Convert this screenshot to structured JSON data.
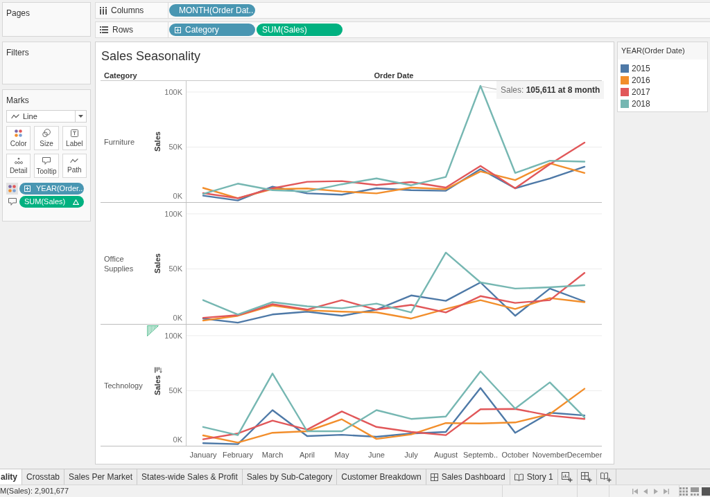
{
  "shelves": {
    "columns": {
      "label": "Columns",
      "pills": [
        {
          "text": "MONTH(Order Dat..",
          "kind": "dimension"
        }
      ]
    },
    "rows": {
      "label": "Rows",
      "pills": [
        {
          "text": "Category",
          "kind": "dimension"
        },
        {
          "text": "SUM(Sales)",
          "kind": "measure"
        }
      ]
    }
  },
  "side_panel": {
    "pages": {
      "title": "Pages"
    },
    "filters": {
      "title": "Filters"
    },
    "marks": {
      "title": "Marks",
      "mark_type": "Line",
      "properties": [
        {
          "label": "Color",
          "kind": "color"
        },
        {
          "label": "Size",
          "kind": "size"
        },
        {
          "label": "Label",
          "kind": "label"
        },
        {
          "label": "Detail",
          "kind": "detail"
        },
        {
          "label": "Tooltip",
          "kind": "tooltip"
        },
        {
          "label": "Path",
          "kind": "path"
        }
      ],
      "encodings": {
        "color": {
          "text": "YEAR(Order..",
          "kind": "dimension"
        },
        "tooltip": {
          "text": "SUM(Sales)",
          "kind": "measure",
          "table_calc": true
        }
      }
    }
  },
  "view": {
    "title": "Sales Seasonality",
    "row_header": "Category",
    "column_header": "Order Date",
    "panes": [
      {
        "category": "Furniture",
        "chart_data": {
          "type": "line",
          "ylabel": "Sales",
          "ylim": [
            0,
            110000
          ],
          "yticks": [
            {
              "value": 0,
              "label": "0K"
            },
            {
              "value": 50000,
              "label": "50K"
            },
            {
              "value": 100000,
              "label": "100K"
            }
          ],
          "grid": true,
          "series": [
            {
              "color": "#4e79a7",
              "values": [
                5900,
                1500,
                14100,
                7900,
                6800,
                12600,
                10900,
                10300,
                30000,
                12600,
                21500,
                32100
              ]
            },
            {
              "color": "#f28e2b",
              "values": [
                12900,
                3500,
                11800,
                12400,
                9700,
                7900,
                13200,
                11800,
                27900,
                20000,
                35300,
                26500
              ]
            },
            {
              "color": "#e15759",
              "values": [
                8200,
                3500,
                12600,
                18500,
                19100,
                15600,
                18200,
                13200,
                32900,
                12600,
                34400,
                54100
              ]
            },
            {
              "color": "#76b7b2",
              "values": [
                7400,
                16800,
                10900,
                9700,
                16200,
                21500,
                15300,
                22900,
                105611,
                26500,
                37600,
                36800
              ]
            }
          ],
          "annotations": [
            "Sales: **105,611 at 8 month**"
          ]
        }
      },
      {
        "category": "Office Supplies",
        "chart_data": {
          "type": "line",
          "ylabel": "Sales",
          "ylim": [
            0,
            110000
          ],
          "yticks": [
            {
              "value": 0,
              "label": "0K"
            },
            {
              "value": 50000,
              "label": "50K"
            },
            {
              "value": 100000,
              "label": "100K"
            }
          ],
          "grid": true,
          "series": [
            {
              "color": "#4e79a7",
              "values": [
                4900,
                1200,
                8600,
                11100,
                7400,
                13000,
                25900,
                21000,
                37700,
                7400,
                32100,
                20400
              ]
            },
            {
              "color": "#f28e2b",
              "values": [
                3100,
                7400,
                16700,
                12300,
                11100,
                10500,
                4900,
                13600,
                21600,
                13600,
                23500,
                19800
              ]
            },
            {
              "color": "#e15759",
              "values": [
                5600,
                8000,
                17900,
                13000,
                21600,
                13000,
                17300,
                10500,
                25300,
                19100,
                21600,
                46300
              ]
            },
            {
              "color": "#76b7b2",
              "values": [
                21600,
                8600,
                19800,
                16000,
                14200,
                18500,
                10500,
                64800,
                37700,
                32100,
                33300,
                35200
              ]
            }
          ]
        }
      },
      {
        "category": "Technology",
        "hovered": true,
        "chart_data": {
          "type": "line",
          "categories": [
            "January",
            "February",
            "March",
            "April",
            "May",
            "June",
            "July",
            "August",
            "Septemb..",
            "October",
            "November",
            "December"
          ],
          "ylabel": "Sales",
          "ylim": [
            0,
            110000
          ],
          "yticks": [
            {
              "value": 0,
              "label": "0K"
            },
            {
              "value": 50000,
              "label": "50K"
            },
            {
              "value": 100000,
              "label": "100K"
            }
          ],
          "grid": true,
          "series": [
            {
              "color": "#4e79a7",
              "values": [
                2400,
                1500,
                32400,
                8800,
                10000,
                8200,
                11200,
                12600,
                52400,
                11800,
                30000,
                27600
              ]
            },
            {
              "color": "#f28e2b",
              "values": [
                9400,
                2900,
                11800,
                13200,
                24100,
                6200,
                10300,
                20600,
                20300,
                21200,
                28800,
                51800
              ]
            },
            {
              "color": "#e15759",
              "values": [
                5900,
                11200,
                22900,
                14700,
                31200,
                17100,
                12600,
                9700,
                33200,
                33500,
                27400,
                24400
              ]
            },
            {
              "color": "#76b7b2",
              "values": [
                17100,
                9700,
                65600,
                13200,
                13200,
                32400,
                24400,
                26500,
                67600,
                33800,
                57600,
                25900
              ]
            }
          ]
        }
      }
    ]
  },
  "legend": {
    "title": "YEAR(Order Date)",
    "items": [
      {
        "label": "2015",
        "color": "#4e79a7"
      },
      {
        "label": "2016",
        "color": "#f28e2b"
      },
      {
        "label": "2017",
        "color": "#e15759"
      },
      {
        "label": "2018",
        "color": "#76b7b2"
      }
    ]
  },
  "sheet_tabs": [
    {
      "label": "ality",
      "kind": "worksheet",
      "selected": true
    },
    {
      "label": "Crosstab",
      "kind": "worksheet",
      "selected": false
    },
    {
      "label": "Sales Per Market",
      "kind": "worksheet",
      "selected": false
    },
    {
      "label": "States-wide Sales & Profit",
      "kind": "worksheet",
      "selected": false
    },
    {
      "label": "Sales by Sub-Category",
      "kind": "worksheet",
      "selected": false
    },
    {
      "label": "Customer Breakdown",
      "kind": "worksheet",
      "selected": false
    },
    {
      "label": "Sales Dashboard",
      "kind": "dashboard",
      "selected": false
    },
    {
      "label": "Story 1",
      "kind": "story",
      "selected": false
    }
  ],
  "new_sheet_buttons": [
    {
      "kind": "worksheet"
    },
    {
      "kind": "dashboard"
    },
    {
      "kind": "story"
    }
  ],
  "status_bar": {
    "summary": "M(Sales): 2,901,677"
  }
}
